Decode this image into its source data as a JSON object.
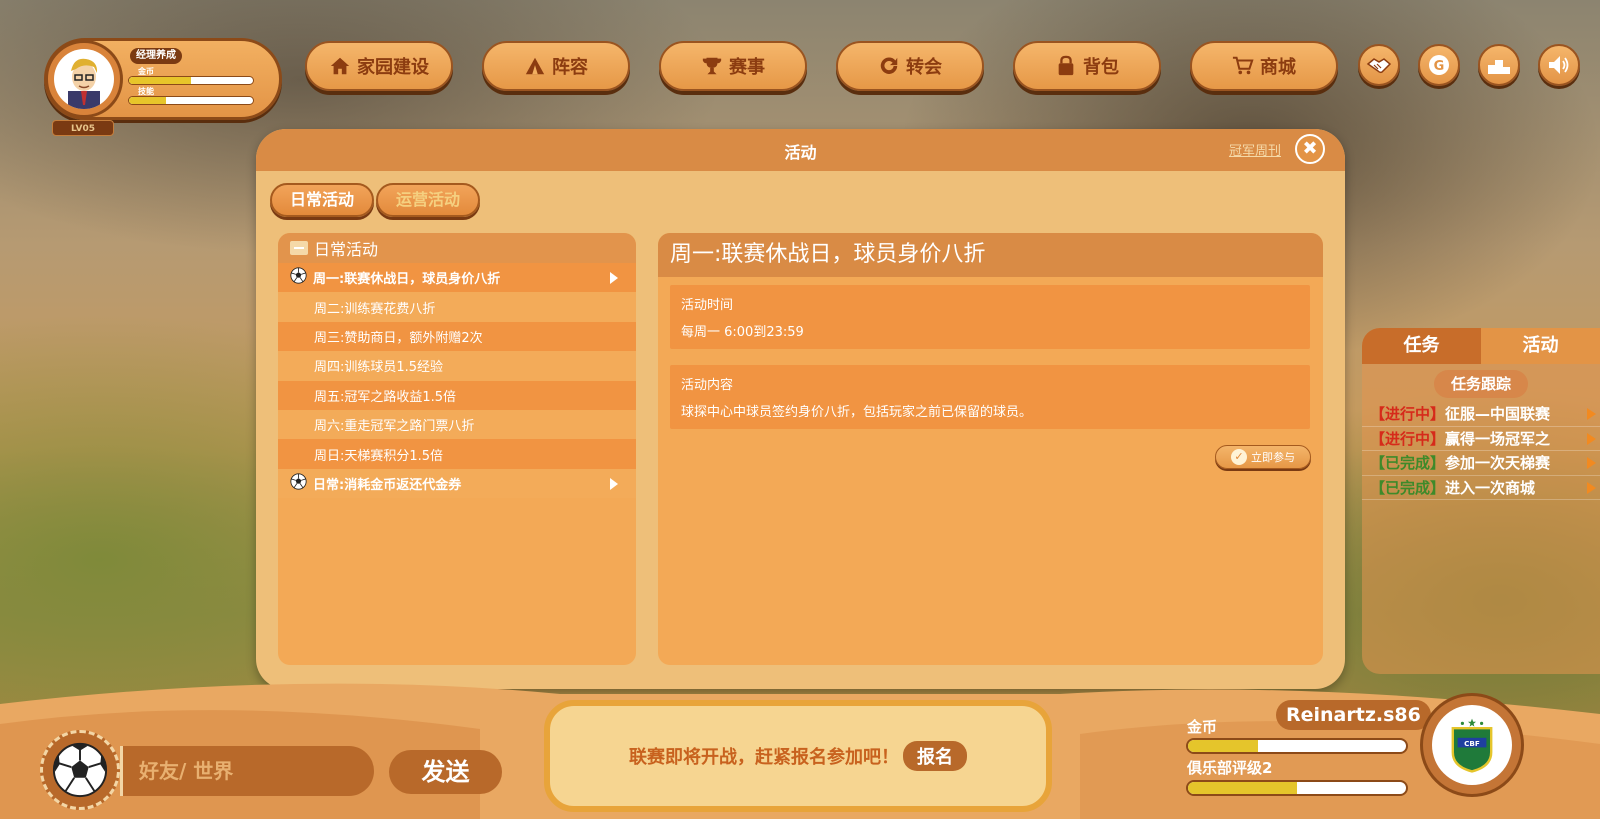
{
  "profile": {
    "title": "经理养成",
    "gold_label": "金币",
    "gold_fill": 0.5,
    "exp_label": "技能",
    "exp_fill": 0.3,
    "level": "LV05"
  },
  "nav": [
    {
      "label": "家园建设",
      "icon": "home-icon"
    },
    {
      "label": "阵容",
      "icon": "tent-icon"
    },
    {
      "label": "赛事",
      "icon": "trophy-icon"
    },
    {
      "label": "转会",
      "icon": "refresh-icon"
    },
    {
      "label": "背包",
      "icon": "bag-icon"
    },
    {
      "label": "商城",
      "icon": "cart-icon"
    }
  ],
  "round_buttons": [
    "handshake-icon",
    "g-coin-icon",
    "podium-icon",
    "speaker-icon"
  ],
  "modal": {
    "title": "活动",
    "link": "冠军周刊",
    "close": "✖",
    "tabs": [
      {
        "label": "日常活动",
        "active": true
      },
      {
        "label": "运营活动",
        "active": false
      }
    ],
    "list_header": "日常活动",
    "list": [
      {
        "label": "周一:联赛休战日，球员身价八折",
        "group": true
      },
      {
        "label": "周二:训练赛花费八折",
        "group": false
      },
      {
        "label": "周三:赞助商日，额外附赠2次",
        "group": false
      },
      {
        "label": "周四:训练球员1.5经验",
        "group": false
      },
      {
        "label": "周五:冠军之路收益1.5倍",
        "group": false
      },
      {
        "label": "周六:重走冠军之路门票八折",
        "group": false
      },
      {
        "label": "周日:天梯赛积分1.5倍",
        "group": false
      },
      {
        "label": "日常:消耗金币返还代金券",
        "group": true
      }
    ],
    "detail": {
      "title": "周一:联赛休战日，球员身价八折",
      "time_label": "活动时间",
      "time_value": "每周一 6:00到23:59",
      "content_label": "活动内容",
      "content_value": "球探中心中球员签约身价八折，包括玩家之前已保留的球员。",
      "join_label": "立即参与"
    }
  },
  "tasks": {
    "tab_task": "任务",
    "tab_activity": "活动",
    "tracking": "任务跟踪",
    "items": [
      {
        "status": "【进行中】",
        "done": false,
        "text": "征服—中国联赛"
      },
      {
        "status": "【进行中】",
        "done": false,
        "text": "赢得一场冠军之"
      },
      {
        "status": "【已完成】",
        "done": true,
        "text": "参加一次天梯赛"
      },
      {
        "status": "【已完成】",
        "done": true,
        "text": "进入一次商城"
      }
    ]
  },
  "bottom": {
    "chat_placeholder": "好友/ 世界",
    "send": "发送",
    "notice": "联赛即将开战，赶紧报名参加吧！",
    "notice_button": "报名",
    "gold_label": "金币",
    "gold_fill": 0.32,
    "club_label": "俱乐部评级2",
    "club_fill": 0.5,
    "player_name": "Reinartz.s86",
    "badge_letters": "CBF"
  },
  "colors": {
    "accent_orange": "#e39446",
    "dark_brown": "#8c4a18",
    "in_progress": "#d62a1a",
    "completed": "#3e8a2a"
  }
}
